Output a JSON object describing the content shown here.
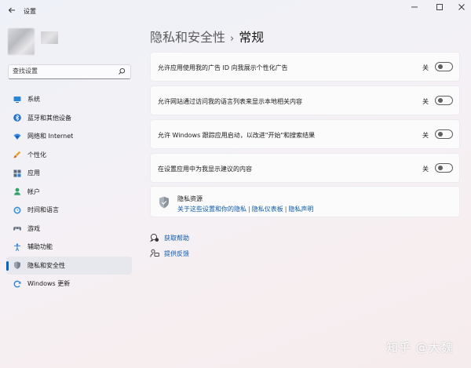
{
  "window": {
    "title": "设置",
    "controls": {
      "minimize": "—",
      "maximize": "☐",
      "close": "✕"
    }
  },
  "search": {
    "placeholder": "查找设置"
  },
  "sidebar": {
    "items": [
      {
        "label": "系统",
        "icon": "monitor-icon"
      },
      {
        "label": "蓝牙和其他设备",
        "icon": "bluetooth-icon"
      },
      {
        "label": "网络和 Internet",
        "icon": "wifi-icon"
      },
      {
        "label": "个性化",
        "icon": "brush-icon"
      },
      {
        "label": "应用",
        "icon": "apps-icon"
      },
      {
        "label": "帐户",
        "icon": "person-icon"
      },
      {
        "label": "时间和语言",
        "icon": "globe-clock-icon"
      },
      {
        "label": "游戏",
        "icon": "gamepad-icon"
      },
      {
        "label": "辅助功能",
        "icon": "accessibility-icon"
      },
      {
        "label": "隐私和安全性",
        "icon": "shield-icon",
        "active": true
      },
      {
        "label": "Windows 更新",
        "icon": "update-icon"
      }
    ]
  },
  "breadcrumb": {
    "parent": "隐私和安全性",
    "separator": "›",
    "current": "常规"
  },
  "settings": [
    {
      "label": "允许应用使用我的广告 ID 向我展示个性化广告",
      "state": "关",
      "on": false
    },
    {
      "label": "允许网站通过访问我的语言列表来显示本地相关内容",
      "state": "关",
      "on": false
    },
    {
      "label": "允许 Windows 跟踪应用启动，以改进\"开始\"和搜索结果",
      "state": "关",
      "on": false
    },
    {
      "label": "在设置应用中为我显示建议的内容",
      "state": "关",
      "on": false
    }
  ],
  "privacy_resources": {
    "title": "隐私资源",
    "links": [
      "关于这些设置和你的隐私",
      "隐私仪表板",
      "隐私声明"
    ],
    "separator": "|"
  },
  "help": {
    "get_help": "获取帮助",
    "feedback": "提供反馈"
  },
  "watermark": "知乎 @大魏",
  "colors": {
    "accent": "#0067c0",
    "link": "#0b5bab"
  }
}
